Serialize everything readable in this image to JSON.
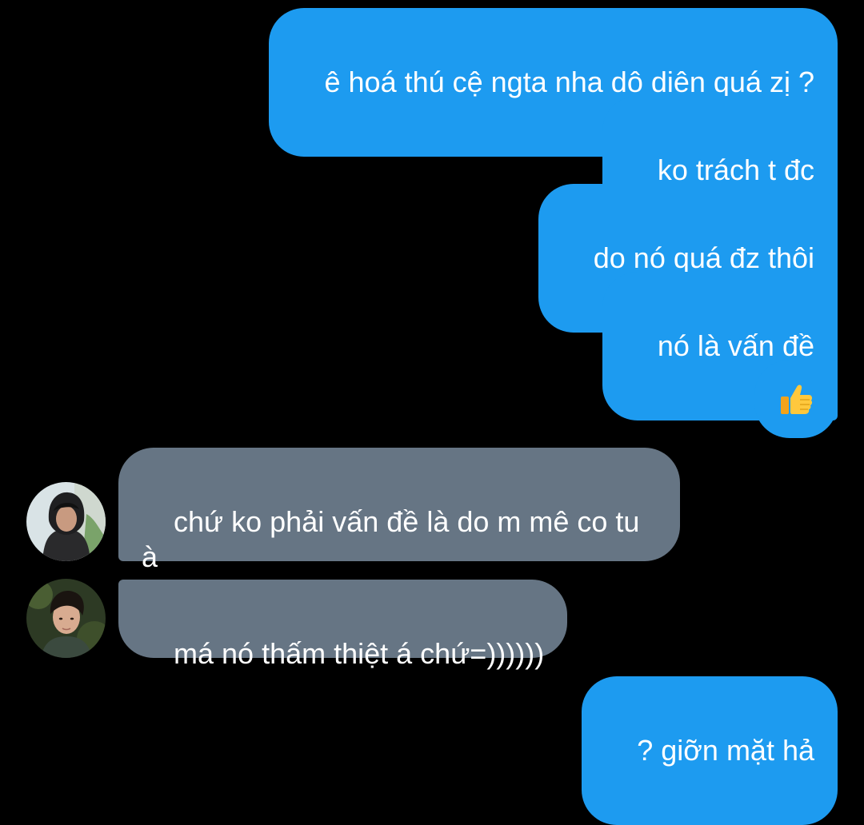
{
  "messages": [
    {
      "text": "ê hoá thú cệ ngta nha dô diên quá zị ?",
      "sender": "me"
    },
    {
      "text": "ko trách t đc",
      "sender": "me"
    },
    {
      "text": "do nó quá đz thôi",
      "sender": "me"
    },
    {
      "text": "nó là vấn đề",
      "sender": "me"
    },
    {
      "text": "👍",
      "sender": "me",
      "icon": "thumbs-up-icon"
    },
    {
      "text": "chứ ko phải vấn đề là do m mê co tu\nà",
      "sender": "other-1"
    },
    {
      "text": "má nó thấm thiệt á chứ=))))))",
      "sender": "other-2"
    },
    {
      "text": "? giỡn mặt hả",
      "sender": "me"
    }
  ],
  "colors": {
    "background": "#000000",
    "outgoing_bubble": "#1d9bf0",
    "incoming_bubble": "#667584",
    "text": "#ffffff"
  }
}
